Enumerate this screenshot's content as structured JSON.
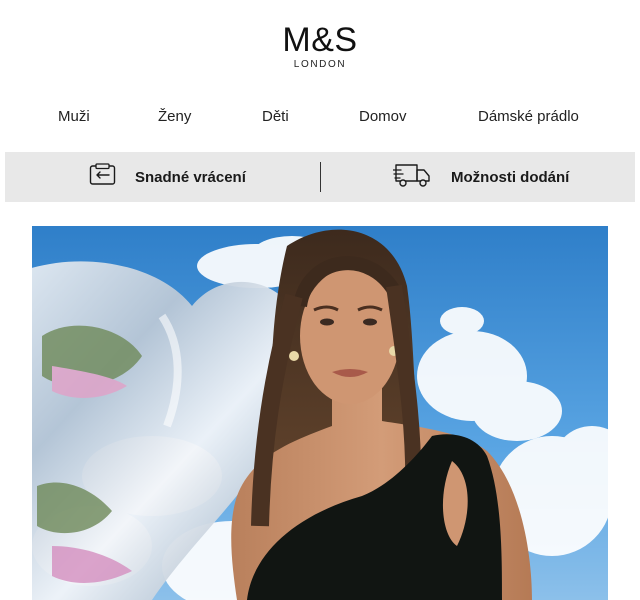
{
  "logo": {
    "main": "M&S",
    "sub": "LONDON"
  },
  "nav": {
    "items": [
      {
        "label": "Muži"
      },
      {
        "label": "Ženy"
      },
      {
        "label": "Děti"
      },
      {
        "label": "Domov"
      },
      {
        "label": "Dámské prádlo"
      }
    ]
  },
  "services": {
    "returns_label": "Snadné vrácení",
    "returns_icon": "return-card-icon",
    "delivery_label": "Možnosti dodání",
    "delivery_icon": "delivery-truck-icon"
  },
  "hero": {
    "image": "model-in-black-cutout-swimsuit-with-silver-balloon-and-sky"
  },
  "colors": {
    "service_bar_bg": "#e8e8e8",
    "text": "#1a1a1a",
    "sky": "#3b8fd6"
  }
}
